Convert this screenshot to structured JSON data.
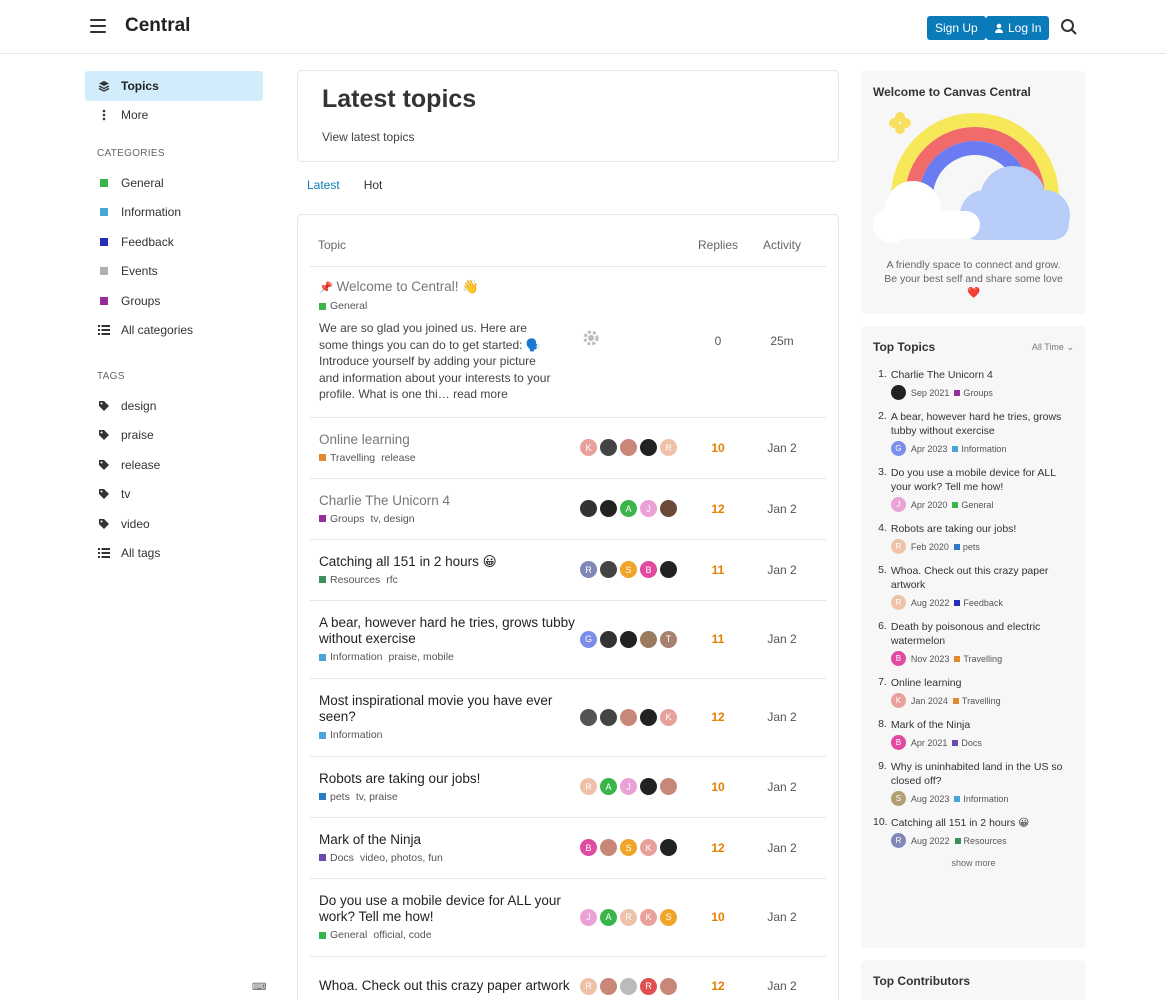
{
  "header": {
    "title": "Central",
    "signup": "Sign Up",
    "login": "Log In"
  },
  "sidebar": {
    "topics": "Topics",
    "more": "More",
    "categories_head": "CATEGORIES",
    "categories": [
      {
        "label": "General",
        "color": "#3ab54a"
      },
      {
        "label": "Information",
        "color": "#4aa5d6"
      },
      {
        "label": "Feedback",
        "color": "#2a2db5"
      },
      {
        "label": "Events",
        "color": "#b0b0b0"
      },
      {
        "label": "Groups",
        "color": "#952f9b"
      }
    ],
    "all_categories": "All categories",
    "tags_head": "TAGS",
    "tags": [
      "design",
      "praise",
      "release",
      "tv",
      "video"
    ],
    "all_tags": "All tags"
  },
  "main": {
    "heading": "Latest topics",
    "subheading": "View latest topics",
    "tabs": [
      "Latest",
      "Hot"
    ],
    "cols": {
      "topic": "Topic",
      "replies": "Replies",
      "activity": "Activity"
    },
    "welcome_topic": {
      "title": "Welcome to Central! 👋",
      "category": "General",
      "excerpt": "We are so glad you joined us. Here are some things you can do to get started: 🗣️ Introduce yourself by adding your picture and information about your interests to your profile. What is one thi…",
      "read_more": "read more",
      "replies": "0",
      "activity": "25m"
    },
    "topics": [
      {
        "title": "Online learning",
        "category": "Travelling",
        "cat_color": "#e08a2a",
        "tags": "release",
        "replies": "10",
        "activity": "Jan 2",
        "visited": true,
        "posters": [
          {
            "l": "K",
            "c": "#e8a19a"
          },
          {
            "l": "",
            "c": "#444"
          },
          {
            "l": "",
            "c": "#c9877a"
          },
          {
            "l": "",
            "c": "#222"
          },
          {
            "l": "R",
            "c": "#eec2a8"
          }
        ]
      },
      {
        "title": "Charlie The Unicorn 4",
        "category": "Groups",
        "cat_color": "#952f9b",
        "tags": "tv, design",
        "replies": "12",
        "activity": "Jan 2",
        "visited": true,
        "posters": [
          {
            "l": "",
            "c": "#333"
          },
          {
            "l": "",
            "c": "#222"
          },
          {
            "l": "A",
            "c": "#3ab54a"
          },
          {
            "l": "J",
            "c": "#eaa1d6"
          },
          {
            "l": "",
            "c": "#6b4a3a"
          }
        ]
      },
      {
        "title": "Catching all 151 in 2 hours 😀",
        "category": "Resources",
        "cat_color": "#3a8f5a",
        "tags": "rfc",
        "replies": "11",
        "activity": "Jan 2",
        "visited": false,
        "posters": [
          {
            "l": "R",
            "c": "#8088b8"
          },
          {
            "l": "",
            "c": "#444"
          },
          {
            "l": "S",
            "c": "#f0a428"
          },
          {
            "l": "B",
            "c": "#e04aa0"
          },
          {
            "l": "",
            "c": "#222"
          }
        ]
      },
      {
        "title": "A bear, however hard he tries, grows tubby without exercise",
        "category": "Information",
        "cat_color": "#4aa5d6",
        "tags": "praise, mobile",
        "replies": "11",
        "activity": "Jan 2",
        "visited": false,
        "posters": [
          {
            "l": "G",
            "c": "#7c8ee8"
          },
          {
            "l": "",
            "c": "#333"
          },
          {
            "l": "",
            "c": "#222"
          },
          {
            "l": "",
            "c": "#9a7a60"
          },
          {
            "l": "T",
            "c": "#a88070"
          }
        ]
      },
      {
        "title": "Most inspirational movie you have ever seen?",
        "category": "Information",
        "cat_color": "#4aa5d6",
        "tags": "",
        "replies": "12",
        "activity": "Jan 2",
        "visited": false,
        "posters": [
          {
            "l": "",
            "c": "#555"
          },
          {
            "l": "",
            "c": "#444"
          },
          {
            "l": "",
            "c": "#c9877a"
          },
          {
            "l": "",
            "c": "#222"
          },
          {
            "l": "K",
            "c": "#e8a19a"
          }
        ]
      },
      {
        "title": "Robots are taking our jobs!",
        "category": "pets",
        "cat_color": "#2a7ac8",
        "tags": "tv, praise",
        "replies": "10",
        "activity": "Jan 2",
        "visited": false,
        "posters": [
          {
            "l": "R",
            "c": "#eec2a8"
          },
          {
            "l": "A",
            "c": "#3ab54a"
          },
          {
            "l": "J",
            "c": "#eaa1d6"
          },
          {
            "l": "",
            "c": "#222"
          },
          {
            "l": "",
            "c": "#c9877a"
          }
        ]
      },
      {
        "title": "Mark of the Ninja",
        "category": "Docs",
        "cat_color": "#6a4ab0",
        "tags": "video, photos, fun",
        "replies": "12",
        "activity": "Jan 2",
        "visited": false,
        "posters": [
          {
            "l": "B",
            "c": "#e04aa0"
          },
          {
            "l": "",
            "c": "#c9877a"
          },
          {
            "l": "S",
            "c": "#f0a428"
          },
          {
            "l": "K",
            "c": "#e8a19a"
          },
          {
            "l": "",
            "c": "#222"
          }
        ]
      },
      {
        "title": "Do you use a mobile device for ALL your work? Tell me how!",
        "category": "General",
        "cat_color": "#3ab54a",
        "tags": "official, code",
        "replies": "10",
        "activity": "Jan 2",
        "visited": false,
        "posters": [
          {
            "l": "J",
            "c": "#eaa1d6"
          },
          {
            "l": "A",
            "c": "#3ab54a"
          },
          {
            "l": "R",
            "c": "#eec2a8"
          },
          {
            "l": "K",
            "c": "#e8a19a"
          },
          {
            "l": "S",
            "c": "#f0a428"
          }
        ]
      },
      {
        "title": "Whoa. Check out this crazy paper artwork",
        "category": "",
        "cat_color": "#2a2db5",
        "tags": "",
        "replies": "12",
        "activity": "Jan 2",
        "visited": false,
        "posters": [
          {
            "l": "R",
            "c": "#eec2a8"
          },
          {
            "l": "",
            "c": "#c9877a"
          },
          {
            "l": "",
            "c": "#bbb"
          },
          {
            "l": "R",
            "c": "#e05050"
          },
          {
            "l": "",
            "c": "#c9877a"
          }
        ]
      }
    ]
  },
  "right": {
    "welcome_title": "Welcome to Canvas Central",
    "welcome_line1": "A friendly space to connect and grow.",
    "welcome_line2": "Be your best self and share some love",
    "heart": "❤️",
    "top_title": "Top Topics",
    "period": "All Time",
    "top": [
      {
        "n": "1.",
        "title": "Charlie The Unicorn 4",
        "date": "Sep 2021",
        "cat": "Groups",
        "cc": "#952f9b",
        "av": "",
        "avc": "#222"
      },
      {
        "n": "2.",
        "title": "A bear, however hard he tries, grows tubby without exercise",
        "date": "Apr 2023",
        "cat": "Information",
        "cc": "#4aa5d6",
        "av": "G",
        "avc": "#7c8ee8"
      },
      {
        "n": "3.",
        "title": "Do you use a mobile device for ALL your work? Tell me how!",
        "date": "Apr 2020",
        "cat": "General",
        "cc": "#3ab54a",
        "av": "J",
        "avc": "#eaa1d6"
      },
      {
        "n": "4.",
        "title": "Robots are taking our jobs!",
        "date": "Feb 2020",
        "cat": "pets",
        "cc": "#2a7ac8",
        "av": "R",
        "avc": "#eec2a8"
      },
      {
        "n": "5.",
        "title": "Whoa. Check out this crazy paper artwork",
        "date": "Aug 2022",
        "cat": "Feedback",
        "cc": "#2a2db5",
        "av": "R",
        "avc": "#eec2a8"
      },
      {
        "n": "6.",
        "title": "Death by poisonous and electric watermelon",
        "date": "Nov 2023",
        "cat": "Travelling",
        "cc": "#e08a2a",
        "av": "B",
        "avc": "#e04aa0"
      },
      {
        "n": "7.",
        "title": "Online learning",
        "date": "Jan 2024",
        "cat": "Travelling",
        "cc": "#e08a2a",
        "av": "K",
        "avc": "#e8a19a"
      },
      {
        "n": "8.",
        "title": "Mark of the Ninja",
        "date": "Apr 2021",
        "cat": "Docs",
        "cc": "#6a4ab0",
        "av": "B",
        "avc": "#e04aa0"
      },
      {
        "n": "9.",
        "title": "Why is uninhabited land in the US so closed off?",
        "date": "Aug 2023",
        "cat": "Information",
        "cc": "#4aa5d6",
        "av": "S",
        "avc": "#b0a070"
      },
      {
        "n": "10.",
        "title": "Catching all 151 in 2 hours 😀",
        "date": "Aug 2022",
        "cat": "Resources",
        "cc": "#3a8f5a",
        "av": "R",
        "avc": "#8088b8"
      }
    ],
    "show_more": "show more",
    "contributors_title": "Top Contributors"
  }
}
